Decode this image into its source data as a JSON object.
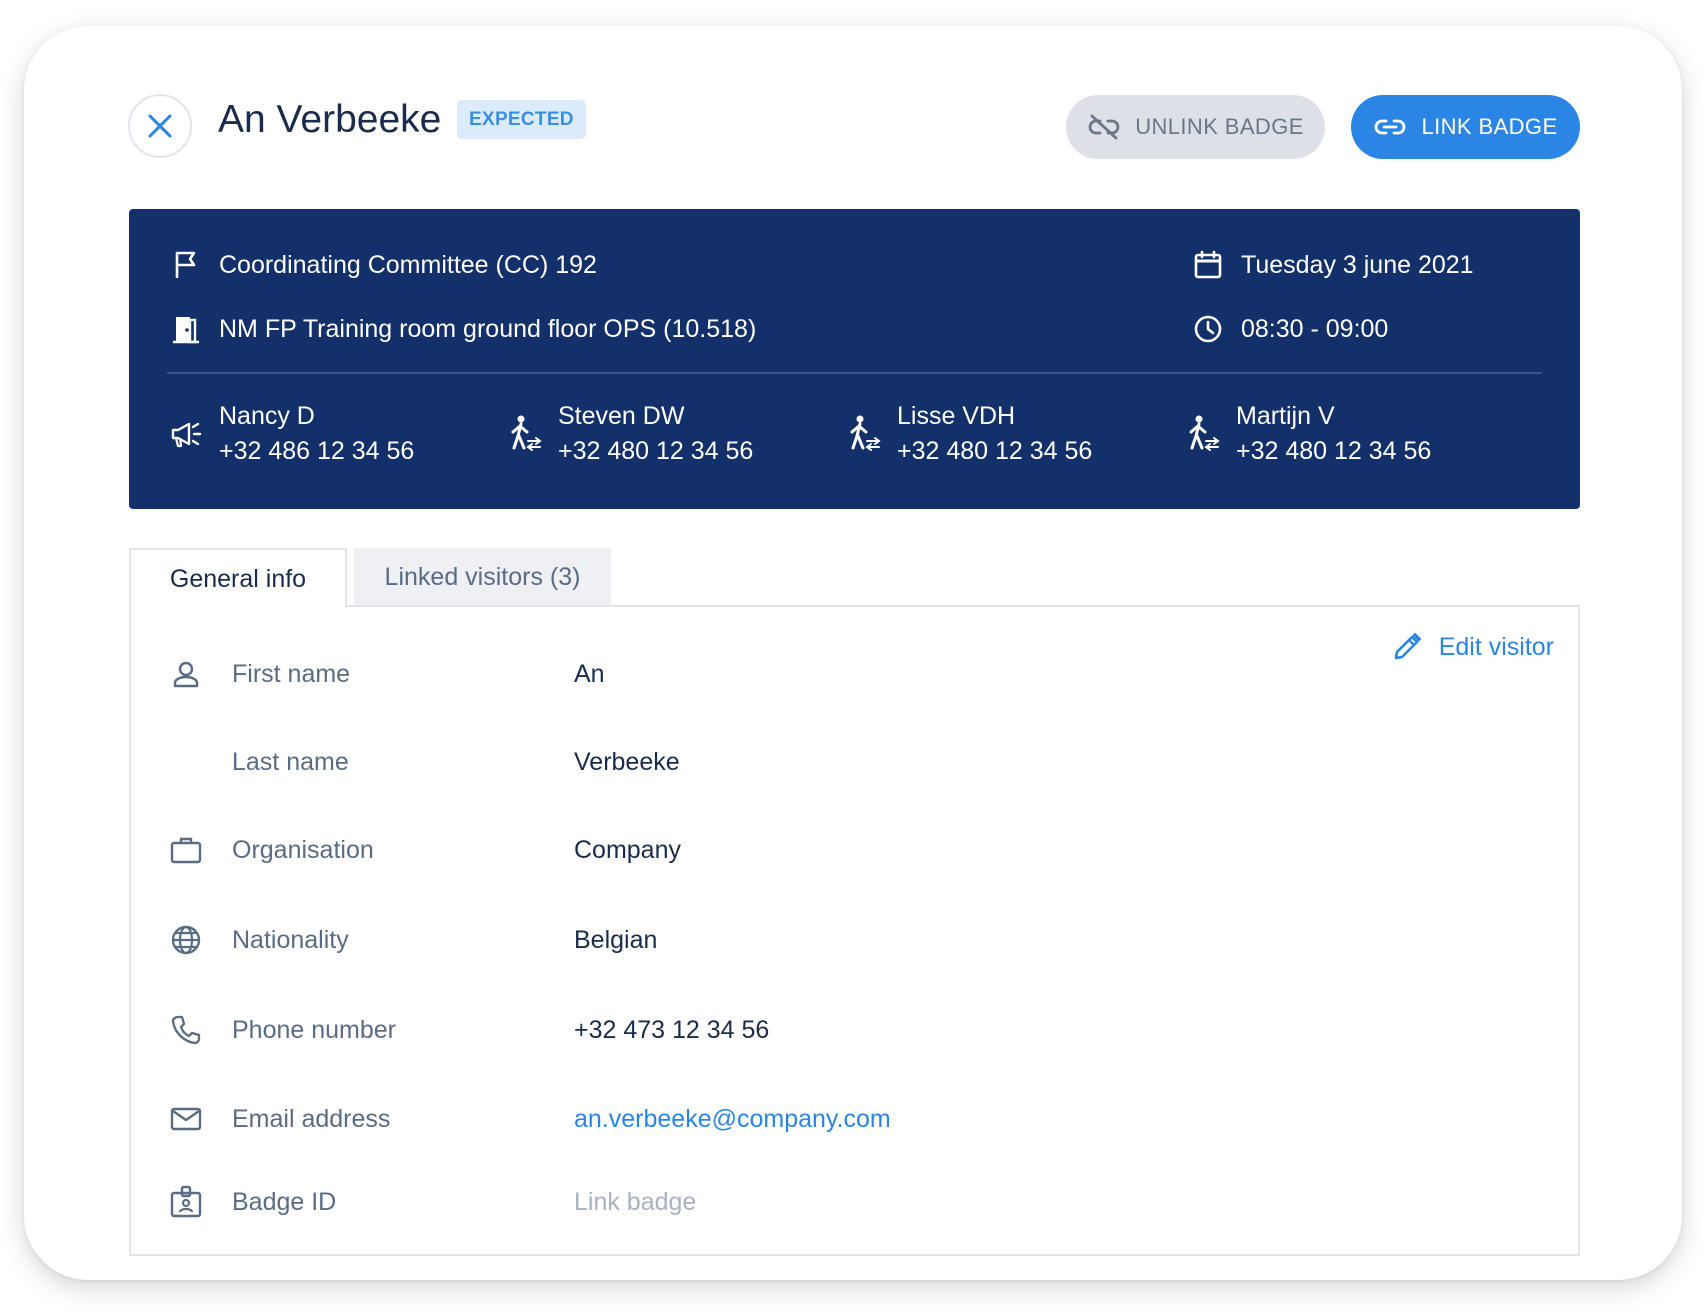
{
  "header": {
    "visitor_name": "An Verbeeke",
    "status": "EXPECTED",
    "unlink_label": "UNLINK BADGE",
    "link_label": "LINK BADGE"
  },
  "meeting": {
    "title": "Coordinating Committee (CC) 192",
    "room": "NM FP Training room ground floor OPS (10.518)",
    "date": "Tuesday 3 june 2021",
    "time": "08:30 - 09:00",
    "contacts": [
      {
        "name": "Nancy D",
        "phone": "+32 486 12 34 56",
        "icon": "megaphone-icon"
      },
      {
        "name": "Steven DW",
        "phone": "+32 480 12 34 56",
        "icon": "walking-person-icon"
      },
      {
        "name": "Lisse VDH",
        "phone": "+32 480 12 34 56",
        "icon": "walking-person-icon"
      },
      {
        "name": "Martijn V",
        "phone": "+32 480 12 34 56",
        "icon": "walking-person-icon"
      }
    ]
  },
  "tabs": [
    {
      "label": "General info",
      "active": true
    },
    {
      "label": "Linked visitors (3)",
      "active": false
    }
  ],
  "general_info": {
    "edit_label": "Edit visitor",
    "fields": [
      {
        "label": "First name",
        "value": "An",
        "icon": "person-icon"
      },
      {
        "label": "Last name",
        "value": "Verbeeke",
        "icon": ""
      },
      {
        "label": "Organisation",
        "value": "Company",
        "icon": "briefcase-icon"
      },
      {
        "label": "Nationality",
        "value": "Belgian",
        "icon": "globe-icon"
      },
      {
        "label": "Phone number",
        "value": "+32 473 12 34 56",
        "icon": "phone-icon"
      },
      {
        "label": "Email address",
        "value": "an.verbeeke@company.com",
        "icon": "mail-icon"
      },
      {
        "label": "Badge ID",
        "value": "Link badge",
        "icon": "badge-icon"
      }
    ]
  },
  "colors": {
    "primary": "#2b85e4",
    "navy": "#13306a",
    "text_dark": "#1a2b4c",
    "text_muted": "#5a6b85"
  }
}
